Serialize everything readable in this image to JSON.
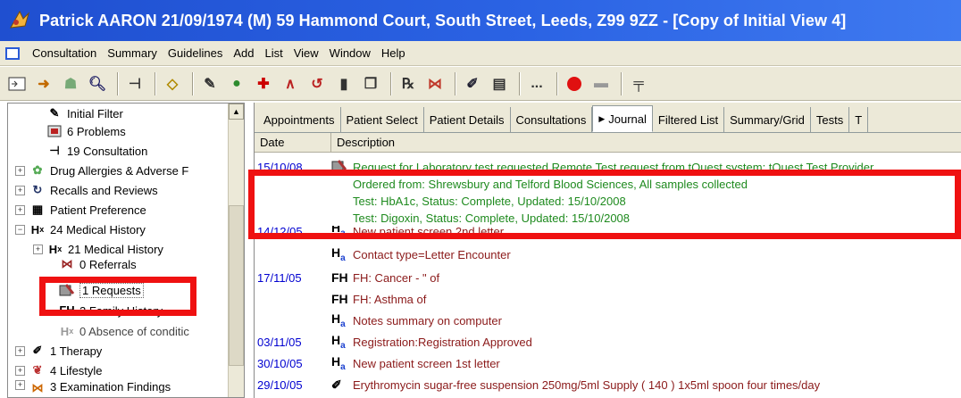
{
  "window": {
    "title": "Patrick AARON 21/09/1974 (M)  59 Hammond Court, South Street, Leeds, Z99 9ZZ - [Copy of Initial View 4]"
  },
  "menu": {
    "items": [
      "Consultation",
      "Summary",
      "Guidelines",
      "Add",
      "List",
      "View",
      "Window",
      "Help"
    ]
  },
  "toolbar": {
    "ellipsis": "..."
  },
  "tree": {
    "items": [
      {
        "label": "Initial Filter",
        "icon": "pencil-icon",
        "expander": ""
      },
      {
        "label": "6 Problems",
        "icon": "problems-icon",
        "expander": ""
      },
      {
        "label": "19 Consultation",
        "icon": "consultation-icon",
        "expander": ""
      },
      {
        "label": "Drug Allergies & Adverse F",
        "icon": "allergy-icon",
        "expander": "+"
      },
      {
        "label": "Recalls and Reviews",
        "icon": "recall-icon",
        "expander": "+"
      },
      {
        "label": "Patient Preference",
        "icon": "preference-icon",
        "expander": "+"
      },
      {
        "label": "24 Medical History",
        "icon": "hx-icon",
        "expander": "−"
      },
      {
        "label": "21 Medical History",
        "icon": "hx-icon",
        "expander": "+"
      },
      {
        "label": "0 Referrals",
        "icon": "referral-icon",
        "expander": ""
      },
      {
        "label": "1 Requests",
        "icon": "request-icon",
        "expander": ""
      },
      {
        "label": "2 Family History",
        "icon": "fh-icon",
        "expander": ""
      },
      {
        "label": "0 Absence of conditic",
        "icon": "absence-icon",
        "expander": ""
      },
      {
        "label": "1 Therapy",
        "icon": "therapy-icon",
        "expander": "+"
      },
      {
        "label": "4 Lifestyle",
        "icon": "lifestyle-icon",
        "expander": "+"
      },
      {
        "label": "3 Examination Findings",
        "icon": "exam-icon",
        "expander": "+"
      }
    ]
  },
  "tabs": {
    "items": [
      "Appointments",
      "Patient Select",
      "Patient Details",
      "Consultations",
      "Journal",
      "Filtered List",
      "Summary/Grid",
      "Tests",
      "T"
    ],
    "active": "Journal"
  },
  "columns": {
    "date": "Date",
    "description": "Description"
  },
  "journal": {
    "request_entry": {
      "date": "15/10/08",
      "lines": [
        "Request for Laboratory test requested Remote Test request from tQuest system: tQuest Test Provider",
        "Ordered from: Shrewsbury and Telford Blood Sciences, All samples collected",
        "Test: HbA1c, Status: Complete, Updated: 15/10/2008",
        "Test: Digoxin, Status: Complete, Updated: 15/10/2008"
      ]
    },
    "rows": [
      {
        "date": "14/12/05",
        "code": "Ha",
        "text": "New patient screen 2nd letter"
      },
      {
        "date": "",
        "code": "Ha",
        "text": "Contact type=Letter Encounter"
      },
      {
        "date": "17/11/05",
        "code": "FH",
        "text": "FH: Cancer - \" of"
      },
      {
        "date": "",
        "code": "FH",
        "text": "FH: Asthma of"
      },
      {
        "date": "",
        "code": "Ha",
        "text": "Notes summary on computer"
      },
      {
        "date": "03/11/05",
        "code": "Ha",
        "text": "Registration:Registration Approved"
      },
      {
        "date": "30/10/05",
        "code": "Ha",
        "text": "New patient screen 1st letter"
      },
      {
        "date": "29/10/05",
        "code": "Rx",
        "text": "Erythromycin sugar-free suspension 250mg/5ml  Supply ( 140 )  1x5ml spoon four times/day"
      }
    ]
  },
  "colors": {
    "highlight": "#ef1111",
    "title_bar": "#2b63e4",
    "date_blue": "#0000d0",
    "entry_red": "#8b1a1a",
    "request_green": "#1e8a1e"
  }
}
